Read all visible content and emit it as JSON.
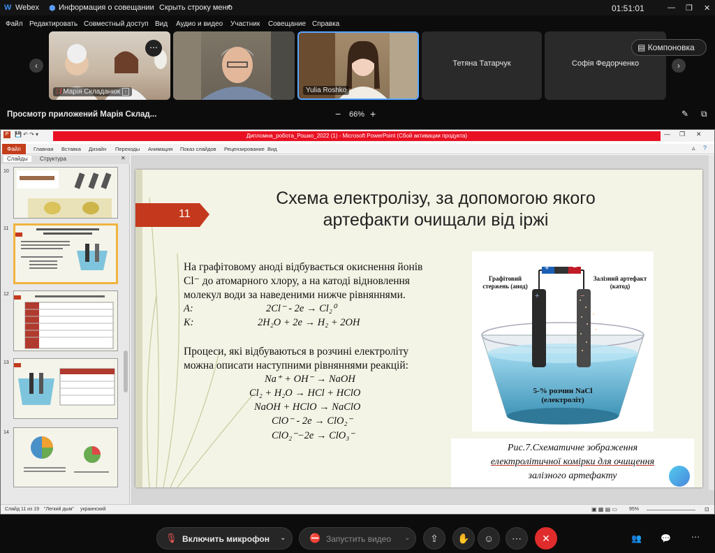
{
  "window": {
    "app": "Webex",
    "meeting_info": "Информация о совещании",
    "hide_menu": "Скрыть строку меню",
    "timer": "01:51:01"
  },
  "menu": [
    "Файл",
    "Редактировать",
    "Совместный доступ",
    "Вид",
    "Аудио и видео",
    "Участник",
    "Совещание",
    "Справка"
  ],
  "participants": {
    "tile1_name": "Марія Складанюк",
    "tile3_name": "Yulia Roshko",
    "tile4_name": "Тетяна Татарчук",
    "tile5_name": "Софія Федорченко",
    "layout_button": "Компоновка"
  },
  "share": {
    "viewing": "Просмотр приложений Марія Склад...",
    "zoom_minus": "−",
    "zoom": "66%",
    "zoom_plus": "+"
  },
  "ppt": {
    "title_text": "Дипломна_робота_Рошко_2022 (1) - Microsoft PowerPoint (Сбой активации продукта)",
    "ribbon_tabs": [
      "Файл",
      "Главная",
      "Вставка",
      "Дизайн",
      "Переходы",
      "Анимация",
      "Показ слайдов",
      "Рецензирование",
      "Вид"
    ],
    "panel_tabs": [
      "Слайды",
      "Структура"
    ],
    "thumb_numbers": [
      "10",
      "11",
      "12",
      "13",
      "14"
    ],
    "status_slide": "Слайд 11 из 19",
    "status_theme": "\"Легкий дым\"",
    "status_lang": "украинский",
    "status_zoom": "95%"
  },
  "slide": {
    "number": "11",
    "title_line1": "Схема електролізу, за допомогою  якого",
    "title_line2": "артефакти очищали від іржі",
    "para1_line1": "На графітовому аноді відбувається окиснення йонів",
    "para1_line2": "Cl⁻ до атомарного хлору, а на катоді відновлення",
    "para1_line3": "молекул води за наведеними нижче рівняннями.",
    "anode_label": "А:",
    "anode_eq": "2Cl⁻ - 2e → Cl₂⁰",
    "cathode_label": "К:",
    "cathode_eq": "2H₂O + 2e → H₂ + 2OH",
    "para2_line1": "Процеси, які відбуваються в розчині електроліту",
    "para2_line2": "можна описати наступними рівняннями реакцій:",
    "reactions": [
      "Na⁺ + OH⁻ → NaOH",
      "Cl₂ + H₂O → HCl + HClO",
      "NaOH + HClO → NaClO",
      "ClO⁻ - 2e → ClO₂⁻",
      "ClO₂⁻−2e → ClO₃⁻"
    ],
    "figure": {
      "label_anode": "Графітовий стержень (анод)",
      "label_cathode": "Залізний артефакт (катод)",
      "label_solution_1": "5-% розчин NaCl",
      "label_solution_2": "(електроліт)",
      "plus": "+",
      "minus": "−"
    },
    "caption_line1": "Рис.7.Схематичне зображення",
    "caption_line2": "електролітичної комірки для очищення",
    "caption_line3": "залізного артефакту"
  },
  "controls": {
    "mic": "Включить микрофон",
    "video": "Запустить видео"
  },
  "colors": {
    "slide_number_bg": "#c4391d",
    "end_call": "#e02c2c",
    "titlebar_red": "#e81123"
  }
}
